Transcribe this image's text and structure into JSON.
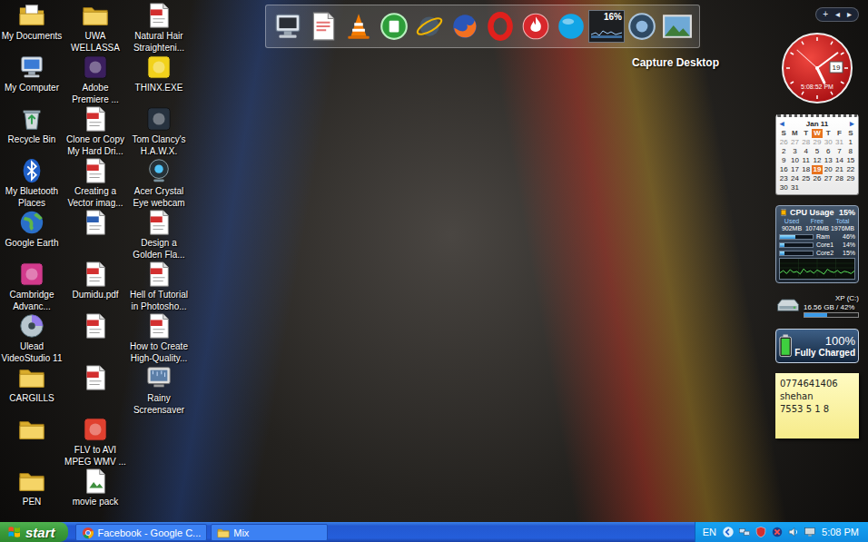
{
  "desktop": {
    "icons": [
      {
        "kind": "mydocs",
        "label": [
          "My Documents"
        ]
      },
      {
        "kind": "computer",
        "label": [
          "My Computer"
        ]
      },
      {
        "kind": "recycle",
        "label": [
          "Recycle Bin"
        ]
      },
      {
        "kind": "bluetooth",
        "label": [
          "My Bluetooth",
          "Places"
        ]
      },
      {
        "kind": "globe",
        "label": [
          "Google Earth"
        ]
      },
      {
        "kind": "app",
        "color": "#d23a8c",
        "label": [
          "Cambridge",
          "Advanc..."
        ]
      },
      {
        "kind": "disc",
        "label": [
          "Ulead",
          "VideoStudio 11"
        ]
      },
      {
        "kind": "folder",
        "label": [
          "CARGILLS"
        ]
      },
      {
        "kind": "folder",
        "label": []
      },
      {
        "kind": "folder",
        "label": [
          "PEN"
        ]
      },
      {
        "kind": "folder",
        "label": [
          "UWA",
          "WELLASSA"
        ]
      },
      {
        "kind": "app",
        "color": "#3b1f5e",
        "label": [
          "Adobe",
          "Premiere ..."
        ]
      },
      {
        "kind": "pdf",
        "label": [
          "Clone or Copy",
          "My Hard Dri..."
        ]
      },
      {
        "kind": "pdf",
        "label": [
          "Creating a",
          "Vector imag..."
        ]
      },
      {
        "kind": "word",
        "label": []
      },
      {
        "kind": "pdf",
        "label": [
          "Dumidu.pdf"
        ]
      },
      {
        "kind": "pdf",
        "label": []
      },
      {
        "kind": "pdf",
        "label": []
      },
      {
        "kind": "app",
        "color": "#e0402f",
        "label": [
          "FLV to AVI",
          "MPEG WMV ..."
        ]
      },
      {
        "kind": "image",
        "label": [
          "movie pack"
        ]
      },
      {
        "kind": "pdf",
        "label": [
          "Natural Hair",
          "Straighteni..."
        ]
      },
      {
        "kind": "app",
        "color": "#f2d21b",
        "label": [
          "THINX.EXE"
        ]
      },
      {
        "kind": "app",
        "color": "#27323f",
        "label": [
          "Tom Clancy's",
          "H.A.W.X."
        ]
      },
      {
        "kind": "webcam",
        "label": [
          "Acer Crystal",
          "Eye webcam"
        ]
      },
      {
        "kind": "pdf",
        "label": [
          "Design a",
          "Golden Fla..."
        ]
      },
      {
        "kind": "pdf",
        "label": [
          "Hell of Tutorial",
          "in Photosho..."
        ]
      },
      {
        "kind": "pdf",
        "label": [
          "How to Create",
          "High-Quality..."
        ]
      },
      {
        "kind": "screensaver",
        "label": [
          "Rainy",
          "Screensaver"
        ]
      }
    ]
  },
  "dock": {
    "items": [
      {
        "kind": "monitor"
      },
      {
        "kind": "document"
      },
      {
        "kind": "cone"
      },
      {
        "kind": "green-orb"
      },
      {
        "kind": "globe-orbit"
      },
      {
        "kind": "firefox"
      },
      {
        "kind": "opera"
      },
      {
        "kind": "flame"
      },
      {
        "kind": "skype"
      },
      {
        "kind": "meter",
        "text": "16%",
        "level": 0.16
      },
      {
        "kind": "dark-orb"
      },
      {
        "kind": "photo"
      }
    ],
    "label": "Capture Desktop"
  },
  "sidebar_controls": [
    "+",
    "◂",
    "▸"
  ],
  "clock": {
    "time": "5:08:52 PM",
    "date": "19"
  },
  "calendar": {
    "title": "Jan 11",
    "prev": "◂",
    "next": "▸",
    "weekdays": [
      {
        "label": "S",
        "selected": false
      },
      {
        "label": "M",
        "selected": false
      },
      {
        "label": "T",
        "selected": false
      },
      {
        "label": "W",
        "selected": true
      },
      {
        "label": "T",
        "selected": false
      },
      {
        "label": "F",
        "selected": false
      },
      {
        "label": "S",
        "selected": false
      }
    ],
    "days": [
      {
        "d": "26",
        "muted": true,
        "selected": false
      },
      {
        "d": "27",
        "muted": true,
        "selected": false
      },
      {
        "d": "28",
        "muted": true,
        "selected": false
      },
      {
        "d": "29",
        "muted": true,
        "selected": false
      },
      {
        "d": "30",
        "muted": true,
        "selected": false
      },
      {
        "d": "31",
        "muted": true,
        "selected": false
      },
      {
        "d": "1",
        "muted": false,
        "selected": false
      },
      {
        "d": "2",
        "muted": false,
        "selected": false
      },
      {
        "d": "3",
        "muted": false,
        "selected": false
      },
      {
        "d": "4",
        "muted": false,
        "selected": false
      },
      {
        "d": "5",
        "muted": false,
        "selected": false
      },
      {
        "d": "6",
        "muted": false,
        "selected": false
      },
      {
        "d": "7",
        "muted": false,
        "selected": false
      },
      {
        "d": "8",
        "muted": false,
        "selected": false
      },
      {
        "d": "9",
        "muted": false,
        "selected": false
      },
      {
        "d": "10",
        "muted": false,
        "selected": false
      },
      {
        "d": "11",
        "muted": false,
        "selected": false
      },
      {
        "d": "12",
        "muted": false,
        "selected": false
      },
      {
        "d": "13",
        "muted": false,
        "selected": false
      },
      {
        "d": "14",
        "muted": false,
        "selected": false
      },
      {
        "d": "15",
        "muted": false,
        "selected": false
      },
      {
        "d": "16",
        "muted": false,
        "selected": false
      },
      {
        "d": "17",
        "muted": false,
        "selected": false
      },
      {
        "d": "18",
        "muted": false,
        "selected": false
      },
      {
        "d": "19",
        "muted": false,
        "selected": true
      },
      {
        "d": "20",
        "muted": false,
        "selected": false
      },
      {
        "d": "21",
        "muted": false,
        "selected": false
      },
      {
        "d": "22",
        "muted": false,
        "selected": false
      },
      {
        "d": "23",
        "muted": false,
        "selected": false
      },
      {
        "d": "24",
        "muted": false,
        "selected": false
      },
      {
        "d": "25",
        "muted": false,
        "selected": false
      },
      {
        "d": "26",
        "muted": false,
        "selected": false
      },
      {
        "d": "27",
        "muted": false,
        "selected": false
      },
      {
        "d": "28",
        "muted": false,
        "selected": false
      },
      {
        "d": "29",
        "muted": false,
        "selected": false
      },
      {
        "d": "30",
        "muted": false,
        "selected": false
      },
      {
        "d": "31",
        "muted": false,
        "selected": false
      }
    ]
  },
  "cpu": {
    "title": "CPU Usage",
    "reading": "15%",
    "columns": [
      "Used",
      "Free",
      "Total"
    ],
    "values": [
      "902MB",
      "1074MB",
      "1976MB"
    ],
    "bars": [
      {
        "name": "Ram",
        "reading": "46%",
        "level": 0.46
      },
      {
        "name": "Core1",
        "reading": "14%",
        "level": 0.14
      },
      {
        "name": "Core2",
        "reading": "15%",
        "level": 0.15
      }
    ],
    "history": [
      22,
      35,
      18,
      40,
      25,
      30,
      16,
      44,
      26,
      34,
      20,
      38,
      28,
      15,
      42,
      30,
      24,
      36,
      20,
      31,
      27,
      18,
      33
    ]
  },
  "drive": {
    "name": "XP (C:)",
    "reading": "16.56 GB / 42%",
    "level": 0.42
  },
  "battery": {
    "reading": "100%",
    "status": "Fully Charged",
    "level": 1
  },
  "note": {
    "lines": [
      "0774641406",
      "shehan",
      "7553 5 1 8"
    ]
  },
  "taskbar": {
    "start": "start",
    "tasks": [
      {
        "label": "Facebook - Google C...",
        "kind": "chrome",
        "selected": false
      },
      {
        "label": "Mix",
        "kind": "folder",
        "selected": false
      }
    ],
    "tray": {
      "language": "EN",
      "icons": [
        {
          "kind": "expand"
        },
        {
          "kind": "network"
        },
        {
          "kind": "shield"
        },
        {
          "kind": "alert"
        },
        {
          "kind": "volume"
        },
        {
          "kind": "display"
        }
      ],
      "time": "5:08 PM"
    }
  }
}
